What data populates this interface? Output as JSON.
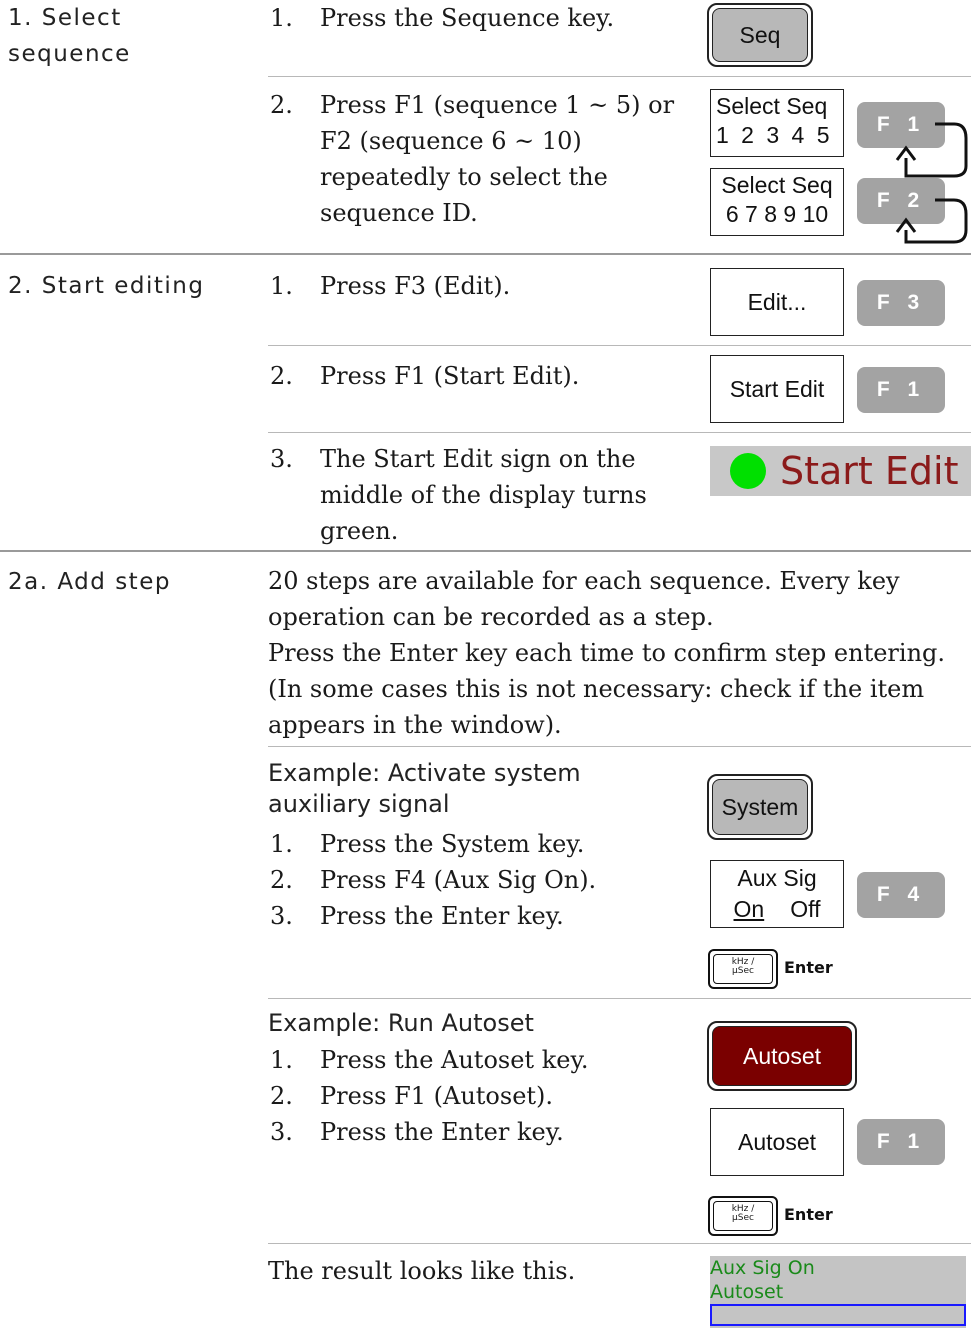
{
  "sections": {
    "s1": {
      "heading_line1": "1. Select",
      "heading_line2": "sequence"
    },
    "s2": {
      "heading": "2. Start editing"
    },
    "s2a": {
      "heading": "2a. Add step"
    }
  },
  "steps": {
    "s1_1": {
      "num": "1.",
      "text": "Press the Sequence key."
    },
    "s1_2": {
      "num": "2.",
      "line1": "Press F1 (sequence 1 ~ 5) or",
      "line2": "F2 (sequence 6 ~ 10)",
      "line3": "repeatedly to select the",
      "line4": "sequence ID."
    },
    "s2_1": {
      "num": "1.",
      "text": "Press F3 (Edit)."
    },
    "s2_2": {
      "num": "2.",
      "text": "Press F1 (Start Edit)."
    },
    "s2_3": {
      "num": "3.",
      "line1": "The Start Edit sign on the",
      "line2": "middle of the display turns",
      "line3": "green."
    }
  },
  "add_step": {
    "para1_line1": "20 steps are available for each sequence. Every key",
    "para1_line2": "operation can be recorded as a step.",
    "para2_line1": "Press the Enter key each time to confirm step entering.",
    "para2_line2": "(In some cases this is not necessary: check if the item",
    "para2_line3": "appears in the window)."
  },
  "example1": {
    "title_line1": "Example: Activate system",
    "title_line2": "auxiliary signal",
    "items": [
      {
        "num": "1.",
        "text": "Press the System key."
      },
      {
        "num": "2.",
        "text": "Press F4 (Aux Sig On)."
      },
      {
        "num": "3.",
        "text": "Press the Enter key."
      }
    ]
  },
  "example2": {
    "title": "Example: Run Autoset",
    "items": [
      {
        "num": "1.",
        "text": "Press the Autoset key."
      },
      {
        "num": "2.",
        "text": "Press F1 (Autoset)."
      },
      {
        "num": "3.",
        "text": "Press the Enter key."
      }
    ]
  },
  "result": {
    "text": "The result looks like this.",
    "line1": "Aux Sig On",
    "line2": "Autoset"
  },
  "keys": {
    "seq": "Seq",
    "system": "System",
    "autoset": "Autoset",
    "select_seq_label": "Select Seq",
    "select_seq_1": "1 2 3 4 5",
    "select_seq_2": "6 7 8 9 10",
    "edit": "Edit...",
    "start_edit": "Start Edit",
    "aux_sig": "Aux Sig",
    "aux_on": "On",
    "aux_off": "Off",
    "autoset_soft": "Autoset",
    "f1": "F 1",
    "f2": "F 2",
    "f3": "F 3",
    "f4": "F 4",
    "enter_small_1": "kHz /",
    "enter_small_2": "μSec",
    "enter_label": "Enter",
    "start_edit_sign": "Start Edit"
  },
  "colors": {
    "autoset_key": "#7a0000",
    "start_edit_text": "#8b1a1a",
    "indicator": "#00e000",
    "result_text": "#1a8a1a"
  }
}
